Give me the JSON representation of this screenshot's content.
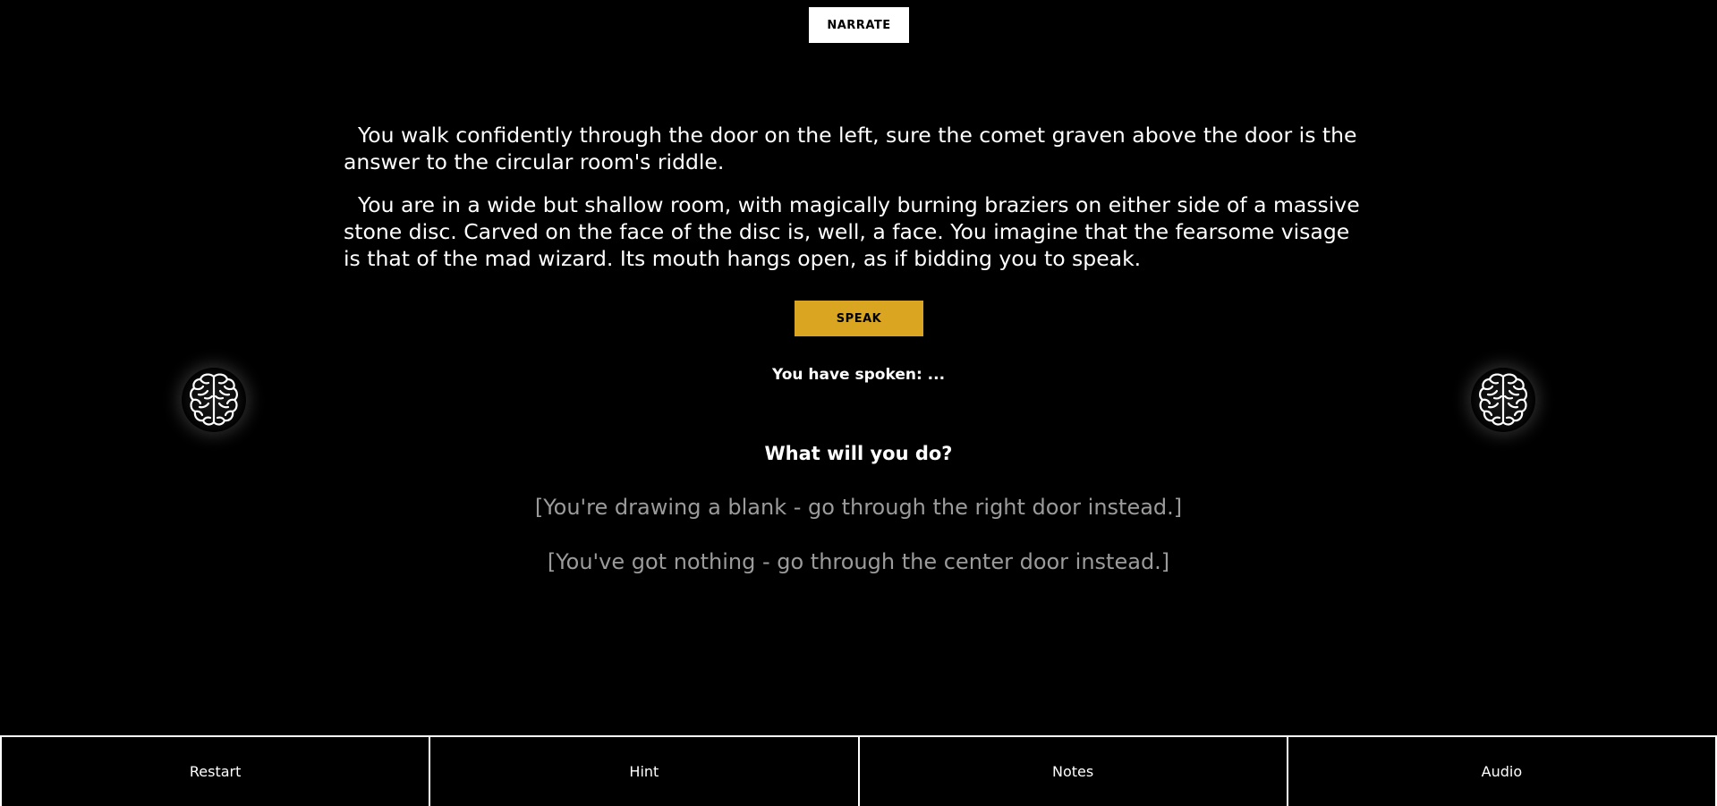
{
  "header": {
    "narrate_label": "NARRATE"
  },
  "story": {
    "paragraphs": [
      "You walk confidently through the door on the left, sure the comet graven above the door is the answer to the circular room's riddle.",
      "You are in a wide but shallow room, with magically burning braziers on either side of a massive stone disc. Carved on the face of the disc is, well, a face. You imagine that the fearsome visage is that of the mad wizard. Its mouth hangs open, as if bidding you to speak."
    ]
  },
  "action": {
    "speak_label": "SPEAK",
    "spoken_text": "You have spoken: ..."
  },
  "side_icons": {
    "left": "brain-icon",
    "right": "brain-icon"
  },
  "prompt": {
    "question": "What will you do?",
    "choices": [
      "[You're drawing a blank - go through the right door instead.]",
      "[You've got nothing - go through the center door instead.]"
    ]
  },
  "bottom_bar": {
    "restart": "Restart",
    "hint": "Hint",
    "notes": "Notes",
    "audio": "Audio"
  },
  "colors": {
    "background": "#000000",
    "text": "#ffffff",
    "speak_button": "#daa520",
    "choice_text": "#9b9b9b"
  }
}
